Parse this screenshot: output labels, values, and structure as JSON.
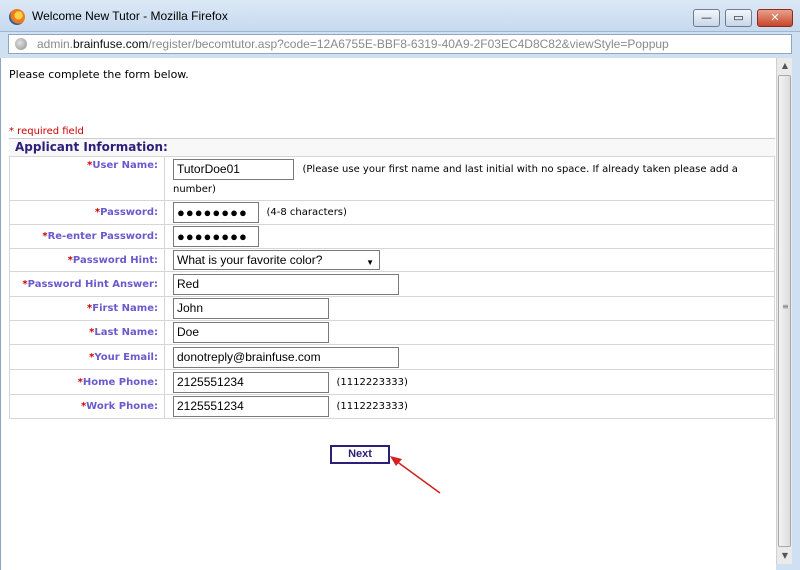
{
  "window": {
    "title": "Welcome New Tutor - Mozilla Firefox",
    "url_prefix": "admin.",
    "url_domain": "brainfuse.com",
    "url_path": "/register/becomtutor.asp?code=12A6755E-BBF8-6319-40A9-2F03EC4D8C82&viewStyle=Poppup"
  },
  "page": {
    "intro": "Please complete the form below.",
    "required_note": "* required field",
    "section_title": "Applicant Information:",
    "next_label": "Next"
  },
  "fields": {
    "username": {
      "label": "User Name:",
      "value": "TutorDoe01",
      "hint": "(Please use your first name and last initial with no space. If already taken please add a number)"
    },
    "password": {
      "label": "Password:",
      "value": "●●●●●●●●",
      "hint": "(4-8 characters)"
    },
    "reenter": {
      "label": "Re-enter Password:",
      "value": "●●●●●●●●"
    },
    "hint_question": {
      "label": "Password Hint:",
      "value": "What is your favorite color?"
    },
    "hint_answer": {
      "label": "Password Hint Answer:",
      "value": "Red"
    },
    "first_name": {
      "label": "First Name:",
      "value": "John"
    },
    "last_name": {
      "label": "Last Name:",
      "value": "Doe"
    },
    "email": {
      "label": "Your Email:",
      "value": "donotreply@brainfuse.com"
    },
    "home_phone": {
      "label": "Home Phone:",
      "value": "2125551234",
      "hint": "(1112223333)"
    },
    "work_phone": {
      "label": "Work Phone:",
      "value": "2125551234",
      "hint": "(1112223333)"
    }
  },
  "colors": {
    "label": "#6a5acd",
    "required": "#cc0000",
    "section": "#2d1e7a",
    "annotation_arrow": "#d42020"
  }
}
